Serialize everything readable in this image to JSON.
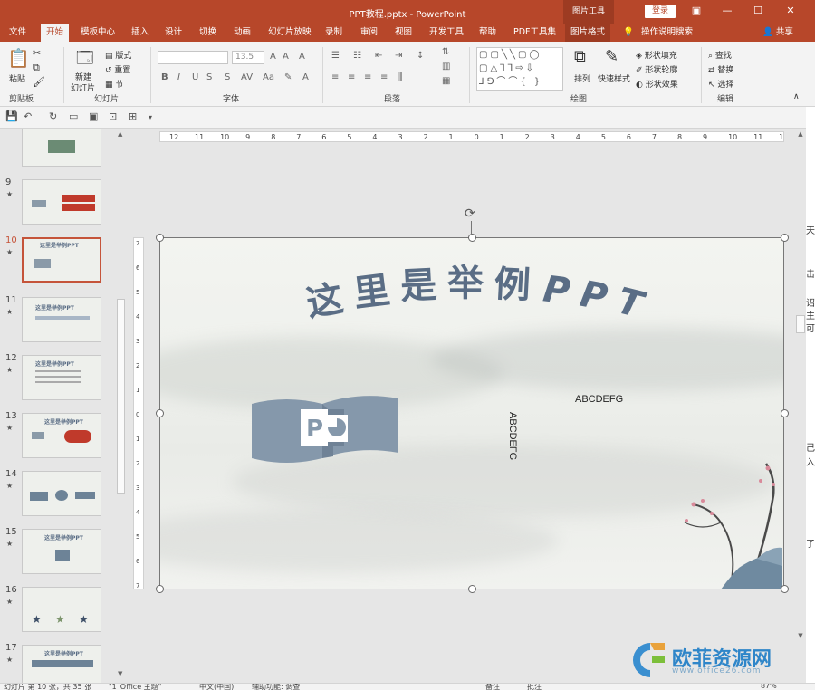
{
  "window": {
    "title": "PPT教程.pptx  -  PowerPoint",
    "tools_tab": "图片工具",
    "login": "登录",
    "buttons": [
      "ribbon-display",
      "minimize",
      "maximize",
      "close"
    ]
  },
  "tabs": [
    {
      "label": "文件"
    },
    {
      "label": "开始"
    },
    {
      "label": "模板中心"
    },
    {
      "label": "插入"
    },
    {
      "label": "设计"
    },
    {
      "label": "切换"
    },
    {
      "label": "动画"
    },
    {
      "label": "幻灯片放映"
    },
    {
      "label": "录制"
    },
    {
      "label": "审阅"
    },
    {
      "label": "视图"
    },
    {
      "label": "开发工具"
    },
    {
      "label": "帮助"
    },
    {
      "label": "PDF工具集"
    },
    {
      "label": "图片格式"
    },
    {
      "label": "操作说明搜索"
    },
    {
      "label": "共享"
    }
  ],
  "ribbon": {
    "clipboard": {
      "paste": "粘贴",
      "label": "剪贴板"
    },
    "slides": {
      "new_slide_1": "新建",
      "new_slide_2": "幻灯片",
      "layout": "版式",
      "reset": "重置",
      "section": "节",
      "label": "幻灯片"
    },
    "font": {
      "size": "13.5",
      "label": "字体",
      "buttons": [
        "B",
        "I",
        "U",
        "S"
      ]
    },
    "paragraph": {
      "label": "段落"
    },
    "drawing": {
      "arrange": "排列",
      "quick_styles": "快速样式",
      "fill": "形状填充",
      "outline": "形状轮廓",
      "effect": "形状效果",
      "label": "绘图"
    },
    "editing": {
      "find": "查找",
      "replace": "替换",
      "select": "选择",
      "label": "编辑"
    }
  },
  "ruler": {
    "h_ticks": [
      "12",
      "11",
      "10",
      "9",
      "8",
      "7",
      "6",
      "5",
      "4",
      "3",
      "2",
      "1",
      "0",
      "1",
      "2",
      "3",
      "4",
      "5",
      "6",
      "7",
      "8",
      "9",
      "10",
      "11",
      "12"
    ],
    "v_ticks": [
      "7",
      "6",
      "5",
      "4",
      "3",
      "2",
      "1",
      "0",
      "1",
      "2",
      "3",
      "4",
      "5",
      "6",
      "7"
    ]
  },
  "thumbnails": [
    {
      "num": "",
      "star": false
    },
    {
      "num": "9",
      "star": true
    },
    {
      "num": "10",
      "star": true,
      "selected": true,
      "title": "这里是举例PPT"
    },
    {
      "num": "11",
      "star": true,
      "title": "这里是举例PPT"
    },
    {
      "num": "12",
      "star": true,
      "title": "这里是举例PPT"
    },
    {
      "num": "13",
      "star": true,
      "title": "这里是举例PPT"
    },
    {
      "num": "14",
      "star": true
    },
    {
      "num": "15",
      "star": true,
      "title": "这里是举例PPT"
    },
    {
      "num": "16",
      "star": true
    },
    {
      "num": "17",
      "star": true,
      "title": "这里是举例PPT"
    }
  ],
  "slide": {
    "title_chars": [
      "这",
      "里",
      "是",
      "举",
      "例",
      "P",
      "P",
      "T"
    ],
    "text_horizontal": "ABCDEFG",
    "text_vertical": "ABCDEFG"
  },
  "right_cut_chars": [
    "天",
    "击",
    "诏",
    "主",
    "可",
    "己",
    "入",
    "了"
  ],
  "statusbar": {
    "slide_info": "幻灯片 第 10 张，共 35 张",
    "theme": "\"1_Office 主题\"",
    "language": "中文(中国)",
    "accessibility": "辅助功能: 调查",
    "notes": "备注",
    "comments": "批注",
    "zoom": "87%"
  },
  "watermark": {
    "text": "欧菲资源网",
    "url": "www.office26.com"
  }
}
